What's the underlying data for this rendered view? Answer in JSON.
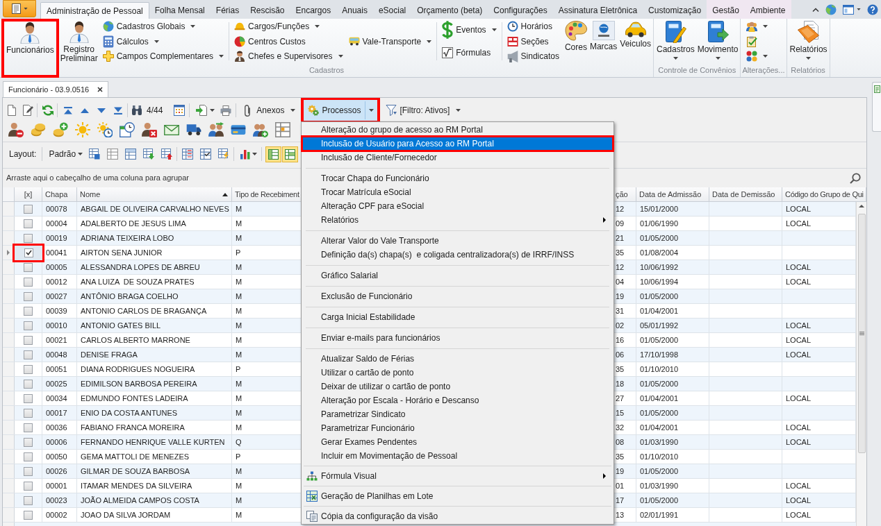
{
  "ribbon": {
    "tabs": [
      {
        "label": "Administração de Pessoal",
        "selected": true,
        "contextual": false
      },
      {
        "label": "Folha Mensal",
        "selected": false,
        "contextual": false
      },
      {
        "label": "Férias",
        "selected": false,
        "contextual": false
      },
      {
        "label": "Rescisão",
        "selected": false,
        "contextual": false
      },
      {
        "label": "Encargos",
        "selected": false,
        "contextual": false
      },
      {
        "label": "Anuais",
        "selected": false,
        "contextual": false
      },
      {
        "label": "eSocial",
        "selected": false,
        "contextual": false
      },
      {
        "label": "Orçamento (beta)",
        "selected": false,
        "contextual": false
      },
      {
        "label": "Configurações",
        "selected": false,
        "contextual": false
      },
      {
        "label": "Assinatura Eletrônica",
        "selected": false,
        "contextual": false
      },
      {
        "label": "Customização",
        "selected": false,
        "contextual": false
      },
      {
        "label": "Gestão",
        "selected": false,
        "contextual": true
      },
      {
        "label": "Ambiente",
        "selected": false,
        "contextual": true
      }
    ],
    "groups": [
      {
        "label": "Cadastros",
        "blocks": [
          {
            "sections": [
              {
                "kind": "large",
                "items": [
                  {
                    "label": "Funcionários",
                    "dropdown": false,
                    "outlined": true
                  },
                  {
                    "label": "Registro Preliminar",
                    "dropdown": false,
                    "outlined": false
                  }
                ]
              },
              {
                "kind": "small",
                "items": [
                  {
                    "label": "Cadastros Globais",
                    "dropdown": true
                  },
                  {
                    "label": "Cálculos",
                    "dropdown": true
                  },
                  {
                    "label": "Campos Complementares",
                    "dropdown": true
                  }
                ]
              }
            ]
          },
          {
            "sections": [
              {
                "kind": "small",
                "items": [
                  {
                    "label": "Cargos/Funções",
                    "dropdown": true
                  },
                  {
                    "label": "Centros Custos",
                    "dropdown": false
                  },
                  {
                    "label": "Chefes e Supervisores",
                    "dropdown": true
                  }
                ]
              },
              {
                "kind": "small",
                "items": [
                  {
                    "label": "Vale-Transporte",
                    "dropdown": true
                  }
                ]
              }
            ]
          },
          {
            "sections": [
              {
                "kind": "small",
                "items": [
                  {
                    "label": "Eventos",
                    "dropdown": true
                  },
                  {
                    "label": "Fórmulas",
                    "dropdown": false
                  }
                ]
              }
            ]
          },
          {
            "sections": [
              {
                "kind": "small",
                "items": [
                  {
                    "label": "Horários",
                    "dropdown": false
                  },
                  {
                    "label": "Seções",
                    "dropdown": false
                  },
                  {
                    "label": "Sindicatos",
                    "dropdown": false
                  }
                ]
              },
              {
                "kind": "large",
                "items": [
                  {
                    "label": "Cores",
                    "dropdown": false,
                    "outlined": false
                  },
                  {
                    "label": "Marcas",
                    "dropdown": false,
                    "outlined": false
                  },
                  {
                    "label": "Veiculos",
                    "dropdown": false,
                    "outlined": false
                  }
                ]
              }
            ]
          }
        ]
      },
      {
        "label": "Controle de Convênios",
        "blocks": [
          {
            "sections": [
              {
                "kind": "large",
                "items": [
                  {
                    "label": "Cadastros",
                    "dropdown": true,
                    "outlined": false
                  },
                  {
                    "label": "Movimento",
                    "dropdown": true,
                    "outlined": false
                  }
                ]
              }
            ]
          }
        ]
      },
      {
        "label": "Alterações...",
        "blocks": [
          {
            "sections": [
              {
                "kind": "icons",
                "items": [
                  {
                    "dropdown": true
                  },
                  {
                    "dropdown": false
                  },
                  {
                    "dropdown": true
                  }
                ]
              }
            ]
          }
        ]
      },
      {
        "label": "Relatórios",
        "blocks": [
          {
            "sections": [
              {
                "kind": "large",
                "items": [
                  {
                    "label": "Relatórios",
                    "dropdown": true,
                    "outlined": false
                  }
                ]
              }
            ]
          }
        ]
      }
    ]
  },
  "document_tabs": [
    {
      "label": "Funcionário - 03.9.0516",
      "selected": true
    }
  ],
  "toolbar": {
    "record_counter": "4/44",
    "menus": [
      {
        "label": "Anexos",
        "expanded": false,
        "outlined": false
      },
      {
        "label": "Processos",
        "expanded": true,
        "outlined": true
      },
      {
        "label": "[Filtro: Ativos]",
        "expanded": false,
        "outlined": false
      }
    ]
  },
  "process_menu": {
    "groups": [
      {
        "items": [
          {
            "label": "Alteração do grupo de acesso ao RM Portal",
            "kind": "text",
            "submenu": false,
            "selected": false,
            "outlined": false
          },
          {
            "label": "Inclusão de Usuário para Acesso ao RM Portal",
            "kind": "text",
            "submenu": false,
            "selected": true,
            "outlined": true
          },
          {
            "label": "Inclusão de Cliente/Fornecedor",
            "kind": "text",
            "submenu": false,
            "selected": false,
            "outlined": false
          }
        ]
      },
      {
        "items": [
          {
            "label": "Trocar Chapa do Funcionário",
            "kind": "text",
            "submenu": false,
            "selected": false,
            "outlined": false
          },
          {
            "label": "Trocar Matrícula eSocial",
            "kind": "text",
            "submenu": false,
            "selected": false,
            "outlined": false
          },
          {
            "label": "Alteração CPF para eSocial",
            "kind": "text",
            "submenu": false,
            "selected": false,
            "outlined": false
          },
          {
            "label": "Relatórios",
            "kind": "text",
            "submenu": true,
            "selected": false,
            "outlined": false
          }
        ]
      },
      {
        "items": [
          {
            "label": "Alterar Valor do Vale Transporte",
            "kind": "text",
            "submenu": false,
            "selected": false,
            "outlined": false
          },
          {
            "label": "Definição da(s) chapa(s)  e coligada centralizadora(s) de IRRF/INSS",
            "kind": "text",
            "submenu": false,
            "selected": false,
            "outlined": false
          }
        ]
      },
      {
        "items": [
          {
            "label": "Gráfico Salarial",
            "kind": "text",
            "submenu": false,
            "selected": false,
            "outlined": false
          }
        ]
      },
      {
        "items": [
          {
            "label": "Exclusão de Funcionário",
            "kind": "text",
            "submenu": false,
            "selected": false,
            "outlined": false
          }
        ]
      },
      {
        "items": [
          {
            "label": "Carga Inicial Estabilidade",
            "kind": "text",
            "submenu": false,
            "selected": false,
            "outlined": false
          }
        ]
      },
      {
        "items": [
          {
            "label": "Enviar e-mails para funcionários",
            "kind": "text",
            "submenu": false,
            "selected": false,
            "outlined": false
          }
        ]
      },
      {
        "items": [
          {
            "label": "Atualizar Saldo de Férias",
            "kind": "text",
            "submenu": false,
            "selected": false,
            "outlined": false
          },
          {
            "label": "Utilizar o cartão de ponto",
            "kind": "text",
            "submenu": false,
            "selected": false,
            "outlined": false
          },
          {
            "label": "Deixar de utilizar o cartão de ponto",
            "kind": "text",
            "submenu": false,
            "selected": false,
            "outlined": false
          },
          {
            "label": "Alteração por Escala - Horário e Descanso",
            "kind": "text",
            "submenu": false,
            "selected": false,
            "outlined": false
          },
          {
            "label": "Parametrizar Sindicato",
            "kind": "text",
            "submenu": false,
            "selected": false,
            "outlined": false
          },
          {
            "label": "Parametrizar Funcionário",
            "kind": "text",
            "submenu": false,
            "selected": false,
            "outlined": false
          },
          {
            "label": "Gerar Exames Pendentes",
            "kind": "text",
            "submenu": false,
            "selected": false,
            "outlined": false
          },
          {
            "label": "Incluir em Movimentação de Pessoal",
            "kind": "text",
            "submenu": false,
            "selected": false,
            "outlined": false
          }
        ]
      },
      {
        "items": [
          {
            "label": "Fórmula Visual",
            "kind": "diagram",
            "submenu": true,
            "selected": false,
            "outlined": false
          }
        ]
      },
      {
        "items": [
          {
            "label": "Geração de Planilhas em Lote",
            "kind": "spreadsheet",
            "submenu": false,
            "selected": false,
            "outlined": false
          }
        ]
      },
      {
        "items": [
          {
            "label": "Cópia da configuração da visão",
            "kind": "copy",
            "submenu": false,
            "selected": false,
            "outlined": false
          }
        ]
      }
    ]
  },
  "layout_bar": {
    "label": "Layout:",
    "preset": "Padrão",
    "toggles": [
      {
        "on": true
      },
      {
        "on": true
      }
    ]
  },
  "group_panel": {
    "hint": "Arraste aqui o cabeçalho de uma coluna para agrupar"
  },
  "table": {
    "columns": [
      {
        "label": "[x]",
        "sorted": false
      },
      {
        "label": "Chapa",
        "sorted": false
      },
      {
        "label": "Nome",
        "sorted": true
      },
      {
        "label": "Tipo de Recebiment",
        "sorted": false
      },
      {
        "label": "ção",
        "sorted": false
      },
      {
        "label": "Data de Admissão",
        "sorted": false
      },
      {
        "label": "Data de Demissão",
        "sorted": false
      },
      {
        "label": "Código do Grupo de Qui",
        "sorted": false
      }
    ],
    "rows": [
      {
        "checked": false,
        "current": false,
        "outlined": false,
        "chapa": "00078",
        "nome": "ABGAIL DE OLIVEIRA CARVALHO NEVES",
        "tipo": "M",
        "column_5": "12",
        "admissao": "15/01/2000",
        "codigo": "LOCAL"
      },
      {
        "checked": false,
        "current": false,
        "outlined": false,
        "chapa": "00004",
        "nome": "ADALBERTO DE JESUS LIMA",
        "tipo": "M",
        "column_5": "09",
        "admissao": "01/06/1990",
        "codigo": "LOCAL"
      },
      {
        "checked": false,
        "current": false,
        "outlined": false,
        "chapa": "00019",
        "nome": "ADRIANA TEIXEIRA LOBO",
        "tipo": "M",
        "column_5": "21",
        "admissao": "01/05/2000"
      },
      {
        "checked": true,
        "current": true,
        "outlined": true,
        "chapa": "00041",
        "nome": "AIRTON SENA JUNIOR",
        "tipo": "P",
        "column_5": "35",
        "admissao": "01/08/2004"
      },
      {
        "checked": false,
        "current": false,
        "outlined": false,
        "chapa": "00005",
        "nome": "ALESSANDRA LOPES DE ABREU",
        "tipo": "M",
        "column_5": "12",
        "admissao": "10/06/1992",
        "codigo": "LOCAL"
      },
      {
        "checked": false,
        "current": false,
        "outlined": false,
        "chapa": "00012",
        "nome": "ANA LUIZA  DE SOUZA PRATES",
        "tipo": "M",
        "column_5": "04",
        "admissao": "10/06/1994",
        "codigo": "LOCAL"
      },
      {
        "checked": false,
        "current": false,
        "outlined": false,
        "chapa": "00027",
        "nome": "ANTÔNIO BRAGA COELHO",
        "tipo": "M",
        "column_5": "19",
        "admissao": "01/05/2000"
      },
      {
        "checked": false,
        "current": false,
        "outlined": false,
        "chapa": "00039",
        "nome": "ANTONIO CARLOS DE BRAGANÇA",
        "tipo": "M",
        "column_5": "31",
        "admissao": "01/04/2001"
      },
      {
        "checked": false,
        "current": false,
        "outlined": false,
        "chapa": "00010",
        "nome": "ANTONIO GATES BILL",
        "tipo": "M",
        "column_5": "02",
        "admissao": "05/01/1992",
        "codigo": "LOCAL"
      },
      {
        "checked": false,
        "current": false,
        "outlined": false,
        "chapa": "00021",
        "nome": "CARLOS ALBERTO MARRONE",
        "tipo": "M",
        "column_5": "16",
        "admissao": "01/05/2000",
        "codigo": "LOCAL"
      },
      {
        "checked": false,
        "current": false,
        "outlined": false,
        "chapa": "00048",
        "nome": "DENISE FRAGA",
        "tipo": "M",
        "column_5": "06",
        "admissao": "17/10/1998",
        "codigo": "LOCAL"
      },
      {
        "checked": false,
        "current": false,
        "outlined": false,
        "chapa": "00051",
        "nome": "DIANA RODRIGUES NOGUEIRA",
        "tipo": "P",
        "column_5": "35",
        "admissao": "01/10/2010"
      },
      {
        "checked": false,
        "current": false,
        "outlined": false,
        "chapa": "00025",
        "nome": "EDIMILSON BARBOSA PEREIRA",
        "tipo": "M",
        "column_5": "18",
        "admissao": "01/05/2000"
      },
      {
        "checked": false,
        "current": false,
        "outlined": false,
        "chapa": "00034",
        "nome": "EDMUNDO FONTES LADEIRA",
        "tipo": "M",
        "column_5": "27",
        "admissao": "01/04/2001",
        "codigo": "LOCAL"
      },
      {
        "checked": false,
        "current": false,
        "outlined": false,
        "chapa": "00017",
        "nome": "ENIO DA COSTA ANTUNES",
        "tipo": "M",
        "column_5": "15",
        "admissao": "01/05/2000"
      },
      {
        "checked": false,
        "current": false,
        "outlined": false,
        "chapa": "00036",
        "nome": "FABIANO FRANCA MOREIRA",
        "tipo": "M",
        "column_5": "32",
        "admissao": "01/04/2001",
        "codigo": "LOCAL"
      },
      {
        "checked": false,
        "current": false,
        "outlined": false,
        "chapa": "00006",
        "nome": "FERNANDO HENRIQUE VALLE KURTEN",
        "tipo": "Q",
        "column_5": "08",
        "admissao": "01/03/1990",
        "codigo": "LOCAL"
      },
      {
        "checked": false,
        "current": false,
        "outlined": false,
        "chapa": "00050",
        "nome": "GEMA MATTOLI DE MENEZES",
        "tipo": "P",
        "column_5": "35",
        "admissao": "01/10/2010"
      },
      {
        "checked": false,
        "current": false,
        "outlined": false,
        "chapa": "00026",
        "nome": "GILMAR DE SOUZA BARBOSA",
        "tipo": "M",
        "column_5": "19",
        "admissao": "01/05/2000"
      },
      {
        "checked": false,
        "current": false,
        "outlined": false,
        "chapa": "00001",
        "nome": "ITAMAR MENDES DA SILVEIRA",
        "tipo": "M",
        "column_5": "01",
        "admissao": "01/03/1990",
        "codigo": "LOCAL"
      },
      {
        "checked": false,
        "current": false,
        "outlined": false,
        "chapa": "00023",
        "nome": "JOÃO ALMEIDA CAMPOS COSTA",
        "tipo": "M",
        "column_5": "17",
        "admissao": "01/05/2000",
        "codigo": "LOCAL"
      },
      {
        "checked": false,
        "current": false,
        "outlined": false,
        "chapa": "00002",
        "nome": "JOAO DA SILVA JORDAM",
        "tipo": "M",
        "column_5": "13",
        "admissao": "02/01/1991",
        "codigo": "LOCAL"
      }
    ]
  }
}
